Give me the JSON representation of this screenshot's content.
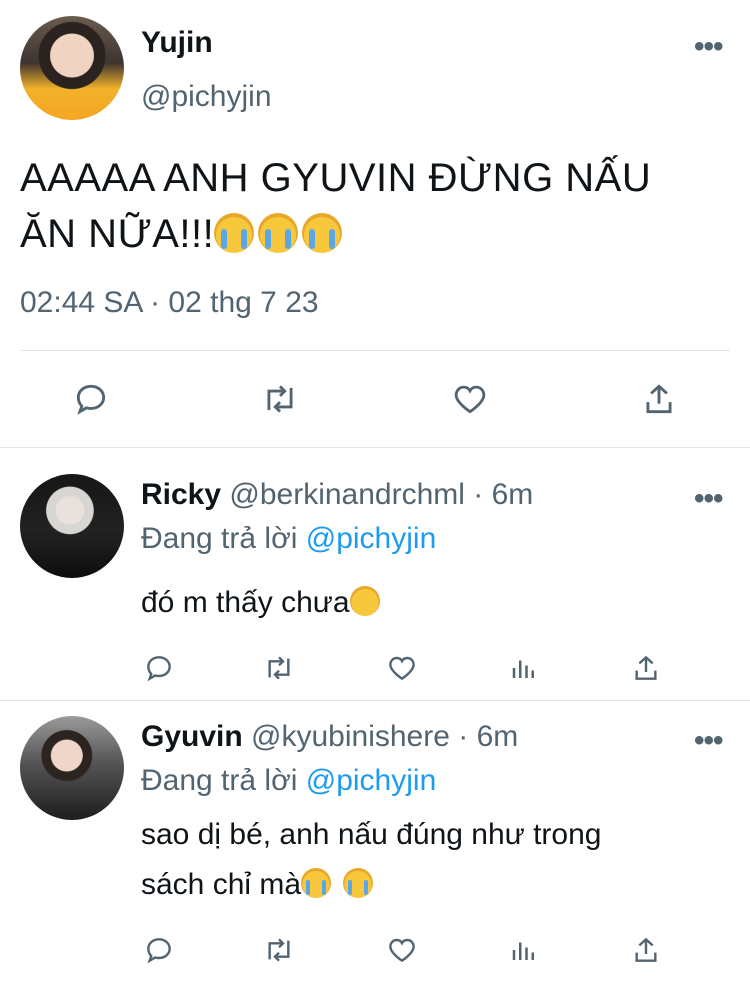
{
  "main_tweet": {
    "name": "Yujin",
    "handle": "@pichyjin",
    "text_line1": "AAAAA ANH GYUVIN ĐỪNG NẤU",
    "text_line2": "ĂN NỮA!!!",
    "emoji": [
      "loudly-crying-face",
      "loudly-crying-face",
      "loudly-crying-face"
    ],
    "timestamp": "02:44 SA · 02 thg 7 23"
  },
  "replies": [
    {
      "name": "Ricky",
      "meta": " @berkinandrchml · 6m",
      "replying_prefix": "Đang trả lời ",
      "replying_to": "@pichyjin",
      "text": "đó m thấy chưa",
      "emoji": [
        "smirking-face"
      ]
    },
    {
      "name": "Gyuvin",
      "meta": " @kyubinishere · 6m",
      "replying_prefix": "Đang trả lời ",
      "replying_to": "@pichyjin",
      "text_line1": "sao dị bé, anh nấu đúng như trong",
      "text_line2": "sách chỉ mà",
      "emoji": [
        "loudly-crying-face",
        "loudly-crying-face"
      ]
    }
  ],
  "icons": {
    "reply": "reply-icon",
    "retweet": "retweet-icon",
    "like": "like-icon",
    "share": "share-icon",
    "stats": "stats-icon",
    "more": "more-icon"
  },
  "colors": {
    "text": "#0f1419",
    "secondary": "#536471",
    "link": "#1d9bf0",
    "divider": "#e1e6ea"
  }
}
